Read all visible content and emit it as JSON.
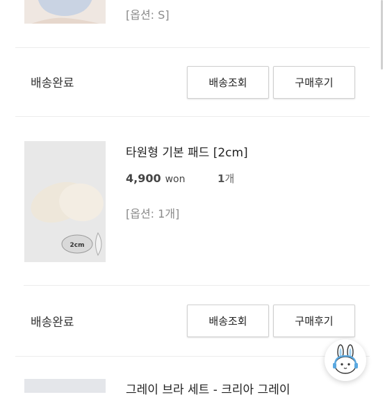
{
  "orders": [
    {
      "option": "[옵션: S]",
      "status": "배송완료",
      "track_label": "배송조회",
      "review_label": "구매후기"
    },
    {
      "title": "타원형 기본 패드 [2cm]",
      "price": "4,900",
      "currency": "won",
      "qty_number": "1",
      "qty_unit": "개",
      "option": "[옵션: 1개]",
      "image_text": "2cm",
      "status": "배송완료",
      "track_label": "배송조회",
      "review_label": "구매후기"
    },
    {
      "title": "그레이 브라 세트 - 크리아 그레이"
    }
  ],
  "chat_button": {
    "icon": "rabbit-chat-icon"
  },
  "colors": {
    "border": "#cfcfcf",
    "divider": "#ececec",
    "muted": "#8a8a8a"
  }
}
